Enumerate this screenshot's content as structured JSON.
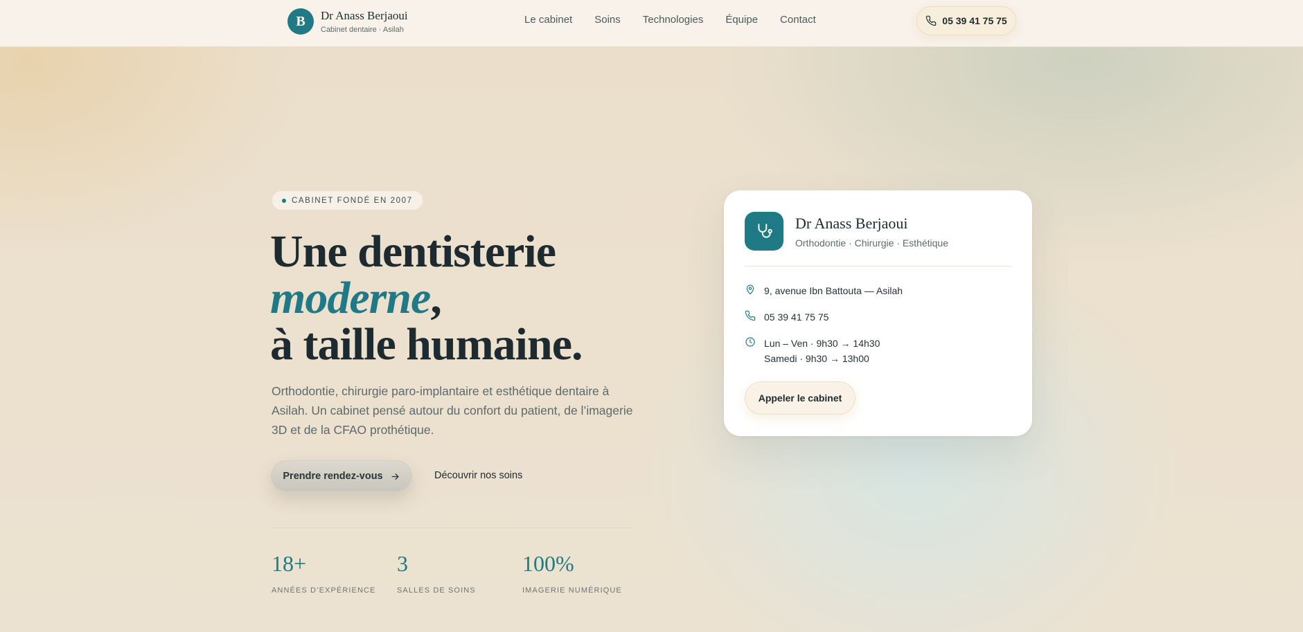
{
  "header": {
    "brand_initial": "B",
    "brand_name": "Dr Anass Berjaoui",
    "brand_sub": "Cabinet dentaire · Asilah",
    "nav": [
      "Le cabinet",
      "Soins",
      "Technologies",
      "Équipe",
      "Contact"
    ],
    "phone": "05 39 41 75 75"
  },
  "hero": {
    "badge": "CABINET FONDÉ EN 2007",
    "headline_line1": "Une dentisterie",
    "headline_accent": "moderne",
    "headline_comma": ",",
    "headline_line3": "à taille humaine.",
    "lede": "Orthodontie, chirurgie paro-implantaire et esthétique dentaire à Asilah. Un cabinet pensé autour du confort du patient, de l’imagerie 3D et de la CFAO prothétique.",
    "cta_primary": "Prendre rendez-vous",
    "cta_secondary": "Découvrir nos soins",
    "stats": [
      {
        "value": "18+",
        "caption": "ANNÉES D’EXPÉRIENCE"
      },
      {
        "value": "3",
        "caption": "SALLES DE SOINS"
      },
      {
        "value": "100%",
        "caption": "IMAGERIE NUMÉRIQUE"
      }
    ]
  },
  "card": {
    "title": "Dr Anass Berjaoui",
    "subtitle": "Orthodontie · Chirurgie · Esthétique",
    "address": "9, avenue Ibn Battouta — Asilah",
    "phone": "05 39 41 75 75",
    "hours_weekday": "Lun – Ven · 9h30 → 14h30",
    "hours_saturday": "Samedi · 9h30 → 13h00",
    "button": "Appeler le cabinet"
  },
  "colors": {
    "accent": "#1f7a86",
    "text": "#1d2b30",
    "background": "#ece1cf"
  },
  "icons": {
    "phone": "phone-icon",
    "arrow": "arrow-right-icon",
    "stethoscope": "stethoscope-icon",
    "location": "map-pin-icon",
    "clock": "clock-icon"
  }
}
